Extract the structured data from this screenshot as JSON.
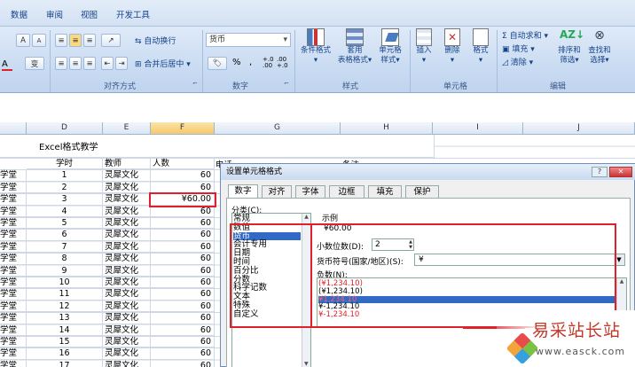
{
  "menu": [
    "数据",
    "审阅",
    "视图",
    "开发工具"
  ],
  "ribbon": {
    "font_buttons": [
      "A",
      "A",
      "变"
    ],
    "wrap_text": "自动换行",
    "merge_center": "合并后居中",
    "number_format": "货币",
    "percent": "%",
    "comma": ",",
    "dec_inc": "+.0 .00",
    "dec_dec": ".00 +.0",
    "cond_format": "条件格式",
    "table_format_1": "套用",
    "table_format_2": "表格格式",
    "cell_style_1": "单元格",
    "cell_style_2": "样式",
    "insert": "插入",
    "delete": "删除",
    "format": "格式",
    "autosum": "自动求和",
    "fill": "填充",
    "clear": "清除",
    "sort_1": "排序和",
    "sort_2": "筛选",
    "find_1": "查找和",
    "find_2": "选择",
    "groups": [
      "对齐方式",
      "数字",
      "样式",
      "单元格",
      "编辑"
    ]
  },
  "sheet": {
    "columns": [
      "D",
      "E",
      "F",
      "G",
      "H",
      "I",
      "J"
    ],
    "title": "Excel格式教学",
    "headers": [
      "学时",
      "教师",
      "人数",
      "电话",
      "备注"
    ],
    "rows": [
      {
        "a": "学堂",
        "d": "1",
        "e": "灵犀文化",
        "f": "60"
      },
      {
        "a": "学堂",
        "d": "2",
        "e": "灵犀文化",
        "f": "60"
      },
      {
        "a": "学堂",
        "d": "3",
        "e": "灵犀文化",
        "f": "¥60.00"
      },
      {
        "a": "学堂",
        "d": "4",
        "e": "灵犀文化",
        "f": "60"
      },
      {
        "a": "学堂",
        "d": "5",
        "e": "灵犀文化",
        "f": "60"
      },
      {
        "a": "学堂",
        "d": "6",
        "e": "灵犀文化",
        "f": "60"
      },
      {
        "a": "学堂",
        "d": "7",
        "e": "灵犀文化",
        "f": "60"
      },
      {
        "a": "学堂",
        "d": "8",
        "e": "灵犀文化",
        "f": "60"
      },
      {
        "a": "学堂",
        "d": "9",
        "e": "灵犀文化",
        "f": "60"
      },
      {
        "a": "学堂",
        "d": "10",
        "e": "灵犀文化",
        "f": "60"
      },
      {
        "a": "学堂",
        "d": "11",
        "e": "灵犀文化",
        "f": "60"
      },
      {
        "a": "学堂",
        "d": "12",
        "e": "灵犀文化",
        "f": "60"
      },
      {
        "a": "学堂",
        "d": "13",
        "e": "灵犀文化",
        "f": "60"
      },
      {
        "a": "学堂",
        "d": "14",
        "e": "灵犀文化",
        "f": "60"
      },
      {
        "a": "学堂",
        "d": "15",
        "e": "灵犀文化",
        "f": "60"
      },
      {
        "a": "学堂",
        "d": "16",
        "e": "灵犀文化",
        "f": "60"
      },
      {
        "a": "学堂",
        "d": "17",
        "e": "灵犀文化",
        "f": "60"
      }
    ]
  },
  "dialog": {
    "title": "设置单元格格式",
    "tabs": [
      "数字",
      "对齐",
      "字体",
      "边框",
      "填充",
      "保护"
    ],
    "category_label": "分类(C):",
    "categories": [
      "常规",
      "数值",
      "货币",
      "会计专用",
      "日期",
      "时间",
      "百分比",
      "分数",
      "科学记数",
      "文本",
      "特殊",
      "自定义"
    ],
    "selected_category": "货币",
    "sample_label": "示例",
    "sample_value": "¥60.00",
    "decimals_label": "小数位数(D):",
    "decimals_value": "2",
    "symbol_label": "货币符号(国家/地区)(S):",
    "symbol_value": "¥",
    "negative_label": "负数(N):",
    "negative_options": [
      "(¥1,234.10)",
      "(¥1,234.10)",
      "¥1,234.10",
      "¥-1,234.10",
      "¥-1,234.10"
    ],
    "selected_negative": 2
  },
  "watermark": {
    "title": "易采站长站",
    "url": "www.easck.com"
  }
}
